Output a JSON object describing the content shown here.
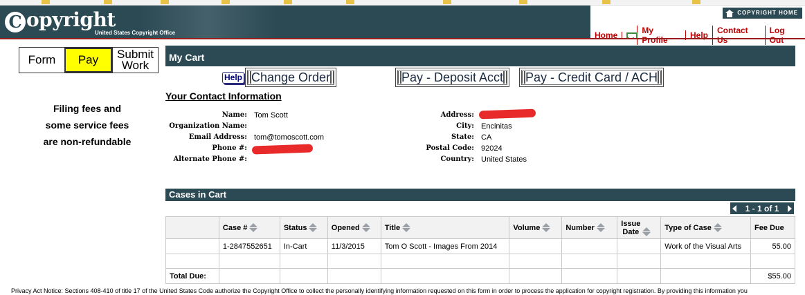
{
  "header": {
    "logo_text": "opyright",
    "logo_c": "C",
    "logo_subtitle": "United States Copyright Office",
    "copyright_home": "COPYRIGHT HOME",
    "nav": {
      "home": "Home",
      "my_profile": "My Profile",
      "help": "Help",
      "contact_us": "Contact Us",
      "log_out": "Log Out"
    }
  },
  "steps": {
    "form": "Form",
    "pay": "Pay",
    "submit_line1": "Submit",
    "submit_line2": "Work"
  },
  "fees_note": {
    "line1": "Filing fees and",
    "line2": "some service fees",
    "line3": "are non-refundable"
  },
  "cart": {
    "title": "My Cart",
    "help": "Help",
    "change_order": "Change Order",
    "pay_deposit": "Pay - Deposit Acct",
    "pay_card": "Pay - Credit Card / ACH"
  },
  "contact": {
    "title": "Your Contact Information",
    "labels": {
      "name": "Name:",
      "org": "Organization Name:",
      "email": "Email Address:",
      "phone": "Phone #:",
      "alt_phone": "Alternate Phone #:",
      "address": "Address:",
      "city": "City:",
      "state": "State:",
      "postal": "Postal Code:",
      "country": "Country:"
    },
    "values": {
      "name": "Tom Scott",
      "org": "",
      "email": "tom@tomoscott.com",
      "alt_phone": "",
      "city": "Encinitas",
      "state": "CA",
      "postal": "92024",
      "country": "United States"
    }
  },
  "cases": {
    "title": "Cases in Cart",
    "pager": "1 - 1 of 1",
    "columns": {
      "case": "Case #",
      "status": "Status",
      "opened": "Opened",
      "title": "Title",
      "volume": "Volume",
      "number": "Number",
      "issue_line1": "Issue",
      "issue_line2": "Date",
      "type": "Type of Case",
      "fee": "Fee Due"
    },
    "row": {
      "case": "1-2847552651",
      "status": "In-Cart",
      "opened": "11/3/2015",
      "title": "Tom O Scott - Images From 2014",
      "volume": "",
      "number": "",
      "issue": "",
      "type": "Work of the Visual Arts",
      "fee": "55.00"
    },
    "total_label": "Total Due:",
    "total_value": "$55.00"
  },
  "privacy_notice": "Privacy Act Notice: Sections 408-410 of title 17 of the United States Code authorize the Copyright Office to collect the personally identifying information requested on this form in order to process the application for copyright registration. By providing this information you",
  "colors": {
    "header_bg": "#2c4a54",
    "nav_link": "#c00000",
    "active_step": "#ffff00",
    "redaction": "#e82a2a"
  }
}
